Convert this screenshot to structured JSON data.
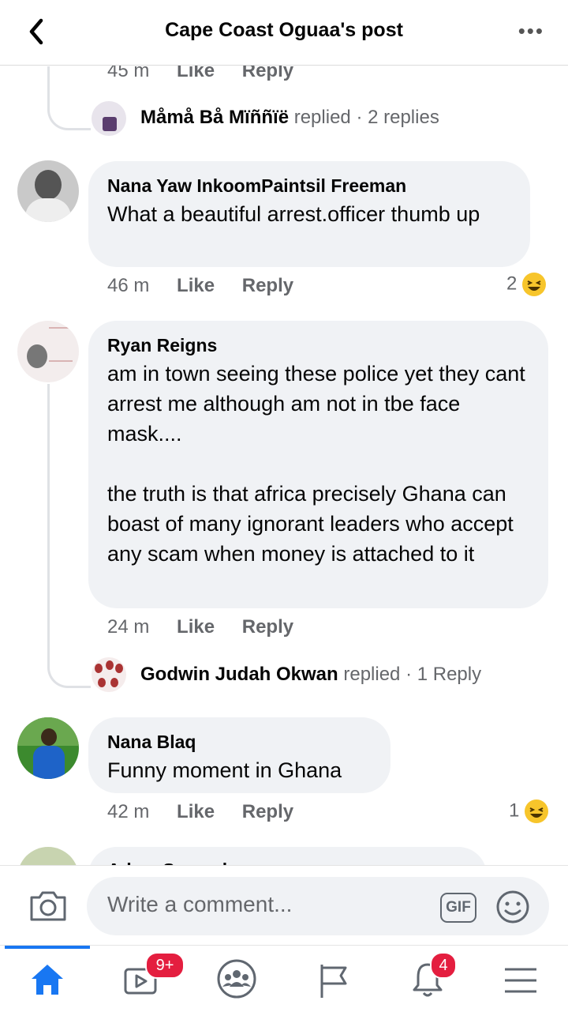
{
  "header": {
    "title": "Cape Coast Oguaa's post",
    "more_label": "•••"
  },
  "comments": [
    {
      "time": "45 m",
      "like": "Like",
      "reply": "Reply",
      "replied_by": "Måmå Bå Mïññïë",
      "replied_word": "replied",
      "reply_count": "· 2 replies"
    },
    {
      "author": "Nana Yaw InkoomPaintsil Freeman",
      "text": "What a beautiful arrest.officer thumb up",
      "time": "46 m",
      "like": "Like",
      "reply": "Reply",
      "reactions": "2"
    },
    {
      "author": "Ryan Reigns",
      "text": "am in town seeing these police yet they cant arrest me although am not in tbe face mask....\n\nthe truth is that africa precisely Ghana can boast of many ignorant leaders who accept any scam when money is attached to it",
      "time": "24 m",
      "like": "Like",
      "reply": "Reply",
      "replied_by": "Godwin Judah Okwan",
      "replied_word": "replied",
      "reply_count": "· 1 Reply"
    },
    {
      "author": "Nana Blaq",
      "text": "Funny moment in Ghana",
      "time": "42 m",
      "like": "Like",
      "reply": "Reply",
      "reactions": "1"
    },
    {
      "author": "Adam Samuel"
    }
  ],
  "composer": {
    "placeholder": "Write a comment...",
    "gif_label": "GIF"
  },
  "nav": {
    "watch_badge": "9+",
    "notifications_badge": "4"
  },
  "colors": {
    "accent": "#1877f2",
    "badge": "#e41e3f",
    "bubble": "#f0f2f5"
  }
}
